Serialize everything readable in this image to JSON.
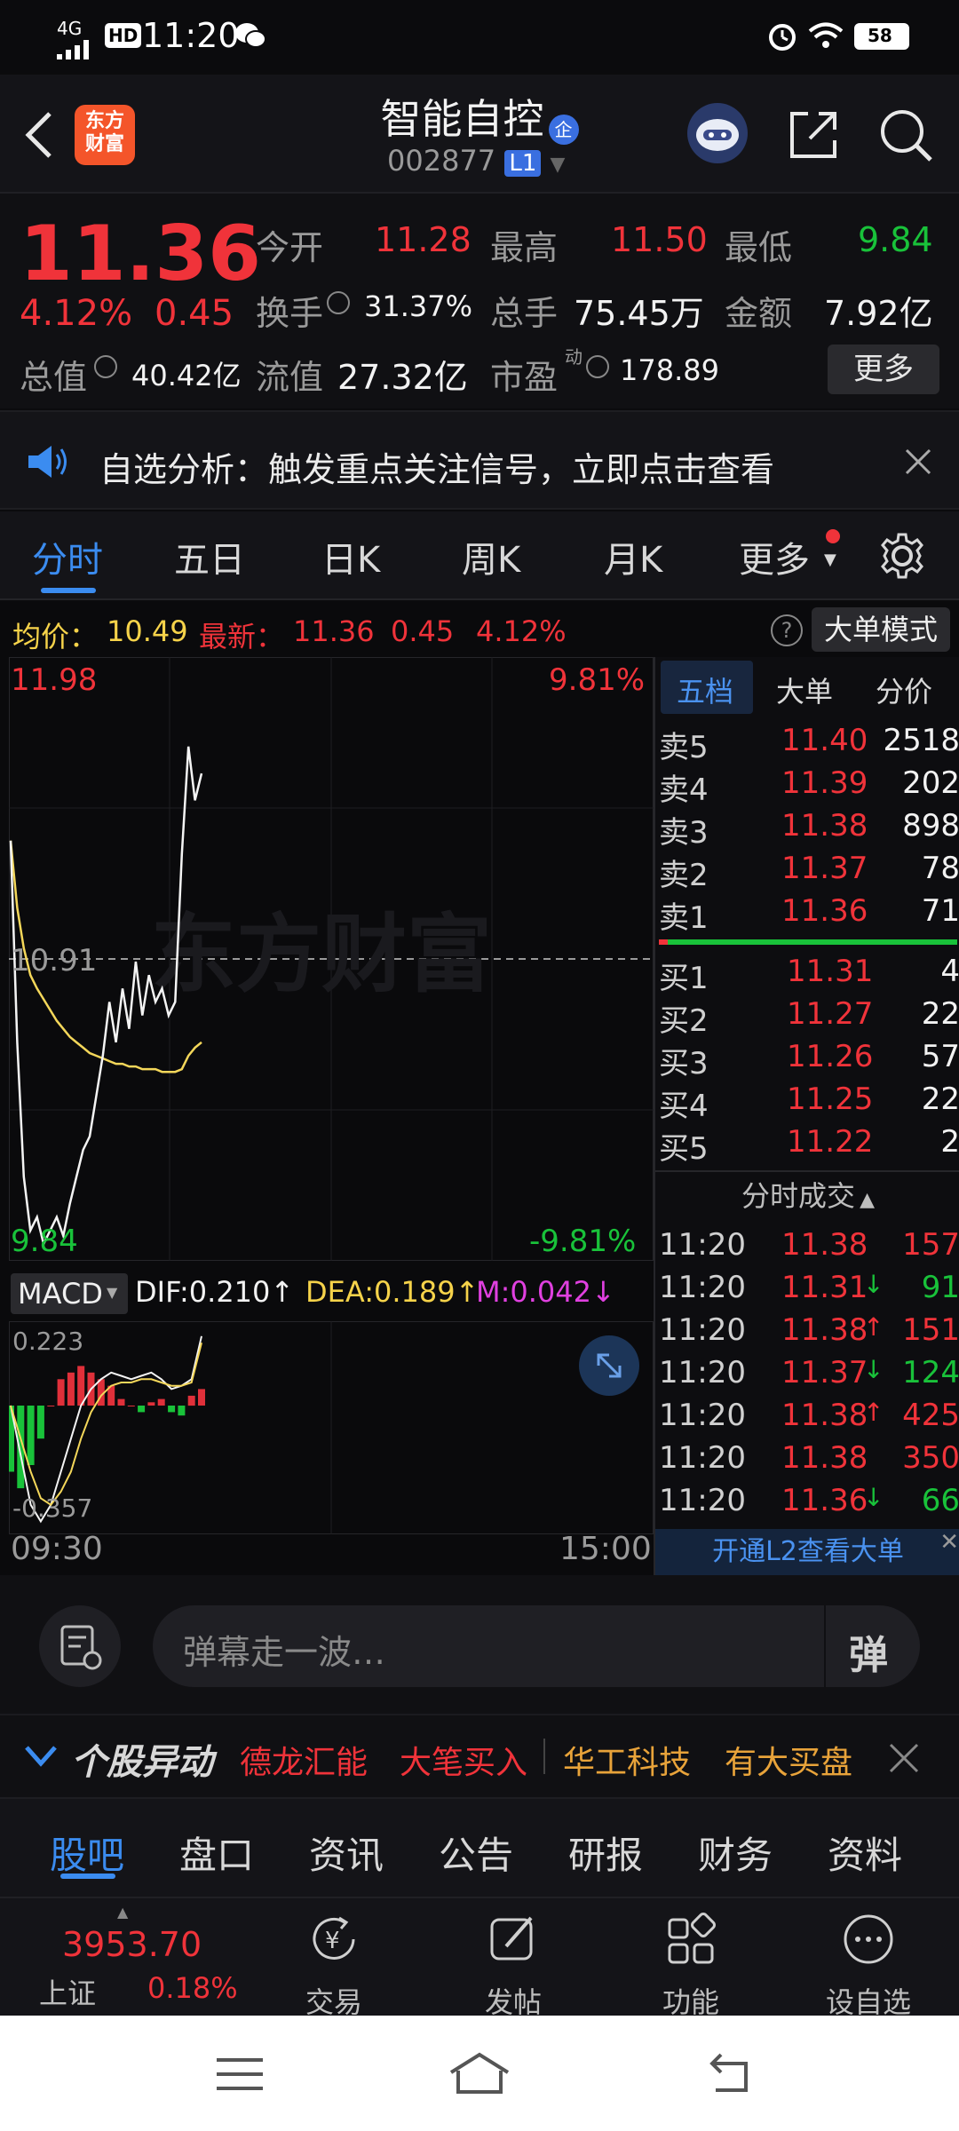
{
  "status": {
    "network": "4G",
    "hd": "HD",
    "time": "11:20",
    "battery": "58"
  },
  "header": {
    "title": "智能自控",
    "badge": "企",
    "code": "002877",
    "level": "L1",
    "logo_top": "东方",
    "logo_bottom": "财富"
  },
  "quote": {
    "price": "11.36",
    "change_pct": "4.12%",
    "change": "0.45",
    "open_label": "今开",
    "open": "11.28",
    "high_label": "最高",
    "high": "11.50",
    "low_label": "最低",
    "low": "9.84",
    "turnover_label": "换手",
    "turnover": "31.37%",
    "volume_label": "总手",
    "volume": "75.45万",
    "amount_label": "金额",
    "amount": "7.92亿",
    "mktcap_label": "总值",
    "mktcap": "40.42亿",
    "float_label": "流值",
    "float": "27.32亿",
    "pe_label": "市盈",
    "pe_sup": "动",
    "pe": "178.89",
    "more_label": "更多"
  },
  "banner": {
    "text": "自选分析：触发重点关注信号，立即点击查看"
  },
  "tabs": [
    "分时",
    "五日",
    "日K",
    "周K",
    "月K",
    "更多"
  ],
  "chart_info": {
    "avg_label": "均价：",
    "avg": "10.49",
    "latest_label": "最新：",
    "latest": "11.36",
    "latest_change": "0.45",
    "latest_pct": "4.12%",
    "mode_label": "大单模式",
    "y_top": "11.98",
    "y_mid": "10.91",
    "y_bottom": "9.84",
    "pct_top": "9.81%",
    "pct_bottom": "-9.81%",
    "watermark": "东方财富",
    "macd_label": "MACD",
    "dif": "DIF:0.210↑",
    "dea": "DEA:0.189↑",
    "m": "M:0.042↓",
    "macd_top": "0.223",
    "macd_bottom": "-0.357",
    "time_start": "09:30",
    "time_end": "15:00"
  },
  "chart_data": {
    "type": "line",
    "title": "",
    "xlabel": "",
    "ylabel": "",
    "ylim": [
      9.84,
      11.98
    ],
    "x_ticks": [
      "09:30",
      "15:00"
    ],
    "series": [
      {
        "name": "最新",
        "values": [
          11.35,
          10.6,
          10.1,
          9.9,
          9.95,
          9.85,
          9.9,
          9.95,
          9.88,
          10.0,
          10.1,
          10.2,
          10.25,
          10.4,
          10.55,
          10.75,
          10.6,
          10.8,
          10.65,
          10.9,
          10.7,
          10.85,
          10.75,
          10.8,
          10.7,
          10.75,
          11.3,
          11.7,
          11.5,
          11.6
        ]
      },
      {
        "name": "均价",
        "values": [
          11.35,
          11.1,
          10.95,
          10.85,
          10.8,
          10.76,
          10.72,
          10.68,
          10.65,
          10.62,
          10.6,
          10.58,
          10.56,
          10.55,
          10.54,
          10.53,
          10.52,
          10.52,
          10.51,
          10.51,
          10.5,
          10.5,
          10.5,
          10.49,
          10.49,
          10.49,
          10.5,
          10.55,
          10.58,
          10.6
        ]
      }
    ],
    "macd": {
      "ylim": [
        -0.357,
        0.223
      ],
      "dif": [
        0.0,
        -0.15,
        -0.3,
        -0.35,
        -0.3,
        -0.2,
        -0.1,
        0.0,
        0.05,
        0.08,
        0.1,
        0.09,
        0.08,
        0.09,
        0.1,
        0.08,
        0.05,
        0.06,
        0.08,
        0.21
      ],
      "dea": [
        0.0,
        -0.1,
        -0.2,
        -0.28,
        -0.3,
        -0.26,
        -0.2,
        -0.1,
        -0.02,
        0.03,
        0.06,
        0.07,
        0.07,
        0.08,
        0.08,
        0.07,
        0.06,
        0.06,
        0.07,
        0.19
      ],
      "hist": [
        -0.2,
        -0.25,
        -0.18,
        -0.1,
        0.0,
        0.08,
        0.1,
        0.12,
        0.1,
        0.08,
        0.06,
        0.02,
        0.0,
        -0.02,
        0.01,
        0.02,
        -0.02,
        -0.03,
        0.03,
        0.05
      ]
    }
  },
  "orderbook": {
    "tabs": [
      "五档",
      "大单",
      "分价"
    ],
    "asks": [
      {
        "label": "卖5",
        "price": "11.40",
        "vol": "2518"
      },
      {
        "label": "卖4",
        "price": "11.39",
        "vol": "202"
      },
      {
        "label": "卖3",
        "price": "11.38",
        "vol": "898"
      },
      {
        "label": "卖2",
        "price": "11.37",
        "vol": "78"
      },
      {
        "label": "卖1",
        "price": "11.36",
        "vol": "71"
      }
    ],
    "bids": [
      {
        "label": "买1",
        "price": "11.31",
        "vol": "4"
      },
      {
        "label": "买2",
        "price": "11.27",
        "vol": "22"
      },
      {
        "label": "买3",
        "price": "11.26",
        "vol": "57"
      },
      {
        "label": "买4",
        "price": "11.25",
        "vol": "22"
      },
      {
        "label": "买5",
        "price": "11.22",
        "vol": "2"
      }
    ],
    "trades_title": "分时成交",
    "trades": [
      {
        "time": "11:20",
        "price": "11.38",
        "arrow": "",
        "vol": "157",
        "dir": "red"
      },
      {
        "time": "11:20",
        "price": "11.31",
        "arrow": "↓",
        "vol": "91",
        "dir": "green"
      },
      {
        "time": "11:20",
        "price": "11.38",
        "arrow": "↑",
        "vol": "151",
        "dir": "red"
      },
      {
        "time": "11:20",
        "price": "11.37",
        "arrow": "↓",
        "vol": "124",
        "dir": "green"
      },
      {
        "time": "11:20",
        "price": "11.38",
        "arrow": "↑",
        "vol": "425",
        "dir": "red"
      },
      {
        "time": "11:20",
        "price": "11.38",
        "arrow": "",
        "vol": "350",
        "dir": "red"
      },
      {
        "time": "11:20",
        "price": "11.36",
        "arrow": "↓",
        "vol": "66",
        "dir": "green"
      }
    ],
    "l2_label": "开通L2查看大单"
  },
  "danmu": {
    "placeholder": "弹幕走一波…",
    "send": "弹"
  },
  "movers": {
    "title": "个股异动",
    "items": [
      "德龙汇能",
      "大笔买入",
      "华工科技",
      "有大买盘"
    ]
  },
  "subtabs": [
    "股吧",
    "盘口",
    "资讯",
    "公告",
    "研报",
    "财务",
    "资料"
  ],
  "bottombar": {
    "index_value": "3953.70",
    "index_name": "上证",
    "index_pct": "0.18%",
    "trade": "交易",
    "post": "发帖",
    "func": "功能",
    "watch": "设自选"
  }
}
